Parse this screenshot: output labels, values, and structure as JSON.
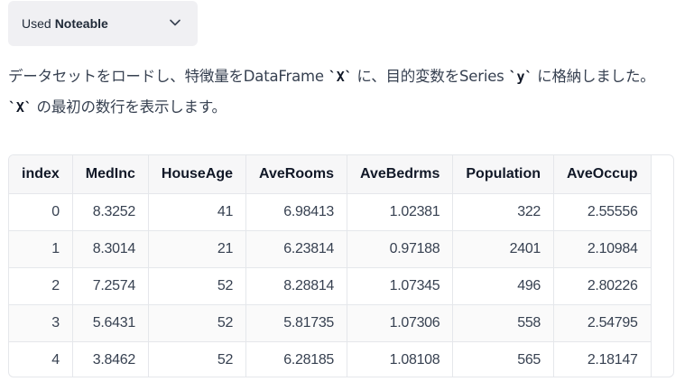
{
  "plugin": {
    "used_label": "Used",
    "name": "Noteable",
    "toggle_icon": "chevron-down-icon"
  },
  "message": {
    "line1_a": "データセットをロードし、特徴量をDataFrame ",
    "code_x": "`X`",
    "line1_b": " に、目的変数をSeries ",
    "code_y": "`y`",
    "line1_c": " に格納しました。",
    "code_x2": "`X`",
    "line2": " の最初の数行を表示します。"
  },
  "table": {
    "columns": [
      "index",
      "MedInc",
      "HouseAge",
      "AveRooms",
      "AveBedrms",
      "Population",
      "AveOccup"
    ],
    "rows": [
      [
        "0",
        "8.3252",
        "41",
        "6.98413",
        "1.02381",
        "322",
        "2.55556"
      ],
      [
        "1",
        "8.3014",
        "21",
        "6.23814",
        "0.97188",
        "2401",
        "2.10984"
      ],
      [
        "2",
        "7.2574",
        "52",
        "8.28814",
        "1.07345",
        "496",
        "2.80226"
      ],
      [
        "3",
        "5.6431",
        "52",
        "5.81735",
        "1.07306",
        "558",
        "2.54795"
      ],
      [
        "4",
        "3.8462",
        "52",
        "6.28185",
        "1.08108",
        "565",
        "2.18147"
      ]
    ]
  }
}
